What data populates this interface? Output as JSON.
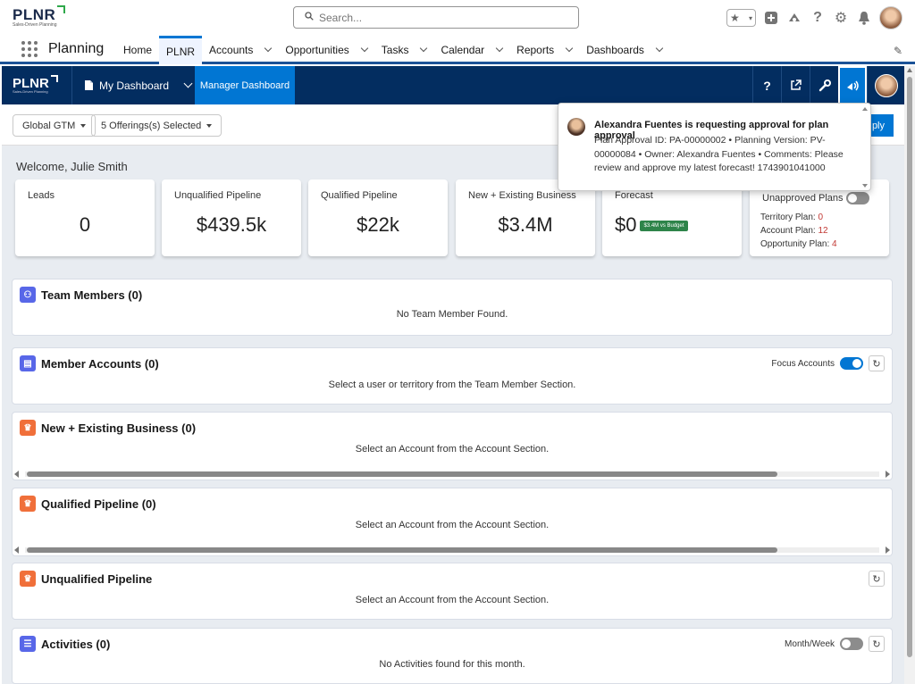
{
  "global_header": {
    "logo_text": "PLNR",
    "logo_tagline": "Sales-Driven Planning",
    "search_placeholder": "Search..."
  },
  "app_nav": {
    "app_name": "Planning",
    "items": [
      {
        "label": "Home",
        "has_menu": false
      },
      {
        "label": "PLNR",
        "has_menu": false,
        "active": true
      },
      {
        "label": "Accounts",
        "has_menu": true
      },
      {
        "label": "Opportunities",
        "has_menu": true
      },
      {
        "label": "Tasks",
        "has_menu": true
      },
      {
        "label": "Calendar",
        "has_menu": true
      },
      {
        "label": "Reports",
        "has_menu": true
      },
      {
        "label": "Dashboards",
        "has_menu": true
      }
    ]
  },
  "plnr_bar": {
    "logo_text": "PLNR",
    "logo_tagline": "Sales-Driven Planning",
    "my_dashboard": "My Dashboard",
    "manager_dashboard": "Manager Dashboard",
    "help_icon": "?"
  },
  "filters": {
    "gtm": "Global GTM",
    "offerings": "5 Offerings(s) Selected",
    "apply_label": "ply"
  },
  "welcome": "Welcome, Julie Smith",
  "kpis": [
    {
      "title": "Leads",
      "value": "0"
    },
    {
      "title": "Unqualified Pipeline",
      "value": "$439.5k"
    },
    {
      "title": "Qualified Pipeline",
      "value": "$22k"
    },
    {
      "title": "New + Existing Business",
      "value": "$3.4M"
    },
    {
      "title": "Forecast",
      "value": "$0",
      "badge": "$3.4M vs Budget"
    }
  ],
  "unapproved": {
    "title": "Unapproved Plans",
    "territory_label": "Territory Plan: ",
    "territory_count": "0",
    "account_label": "Account Plan: ",
    "account_count": "12",
    "opportunity_label": "Opportunity Plan: ",
    "opportunity_count": "4"
  },
  "cards": {
    "team_members": {
      "title": "Team Members (0)",
      "message": "No Team Member Found."
    },
    "member_accounts": {
      "title": "Member Accounts (0)",
      "message": "Select a user or territory from the Team Member Section.",
      "focus_label": "Focus Accounts"
    },
    "new_existing": {
      "title": "New + Existing Business (0)",
      "message": "Select an Account from the Account Section."
    },
    "qualified": {
      "title": "Qualified Pipeline (0)",
      "message": "Select an Account from the Account Section."
    },
    "unqualified": {
      "title": "Unqualified Pipeline",
      "message": "Select an Account from the Account Section."
    },
    "activities": {
      "title": "Activities (0)",
      "message": "No Activities found for this month.",
      "toggle_label": "Month/Week"
    }
  },
  "notification": {
    "title": "Alexandra Fuentes is requesting approval for plan approval",
    "body": "Plan Approval ID: PA-00000002 • Planning Version: PV-00000084 • Owner: Alexandra Fuentes • Comments: Please review and approve my latest forecast! 1743901041000"
  },
  "colors": {
    "brand_navy": "#032d60",
    "brand_blue": "#0176d3",
    "badge_green": "#2e844a",
    "count_red": "#c23934"
  }
}
